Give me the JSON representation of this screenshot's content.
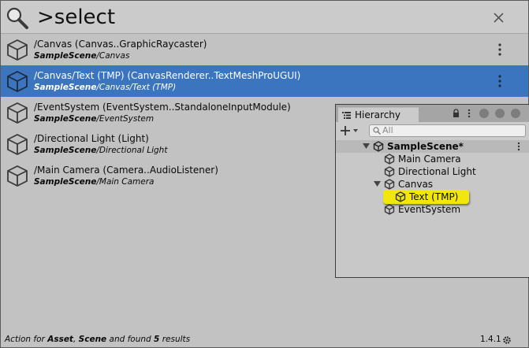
{
  "search": {
    "query": ">select",
    "icon": "search-icon",
    "close_icon": "close-icon"
  },
  "results": [
    {
      "title": "/Canvas (Canvas..GraphicRaycaster)",
      "scene": "SampleScene",
      "path": "/Canvas",
      "selected": false
    },
    {
      "title": "/Canvas/Text (TMP) (CanvasRenderer..TextMeshProUGUI)",
      "scene": "SampleScene",
      "path": "/Canvas/Text (TMP)",
      "selected": true
    },
    {
      "title": "/EventSystem (EventSystem..StandaloneInputModule)",
      "scene": "SampleScene",
      "path": "/EventSystem",
      "selected": false
    },
    {
      "title": "/Directional Light (Light)",
      "scene": "SampleScene",
      "path": "/Directional Light",
      "selected": false
    },
    {
      "title": "/Main Camera (Camera..AudioListener)",
      "scene": "SampleScene",
      "path": "/Main Camera",
      "selected": false
    }
  ],
  "status": {
    "prefix": "Action for ",
    "provider1": "Asset",
    "sep": ", ",
    "provider2": "Scene",
    "mid": " and found ",
    "count": "5",
    "suffix": " results",
    "version": "1.4.1"
  },
  "hierarchy": {
    "tab_label": "Hierarchy",
    "search_placeholder": "All",
    "scene_name": "SampleScene*",
    "items": {
      "main_camera": "Main Camera",
      "directional_light": "Directional Light",
      "canvas": "Canvas",
      "text_tmp": "Text (TMP)",
      "event_system": "EventSystem"
    },
    "highlight_color": "#f2e70c"
  },
  "colors": {
    "selection": "#3b74bf",
    "background": "#c2c2c2"
  }
}
